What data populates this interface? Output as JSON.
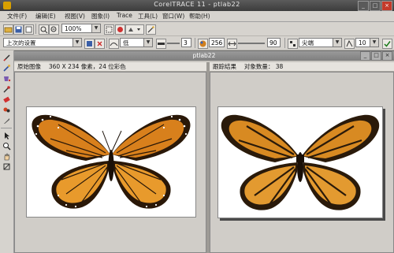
{
  "app": {
    "title": "CorelTRACE 11 - ptlab22"
  },
  "window_buttons": {
    "minimize": "_",
    "maximize": "□",
    "close": "×"
  },
  "menu": [
    "文件(F)",
    "编辑(E)",
    "视图(V)",
    "图象(I)",
    "Trace",
    "工具(L)",
    "窗口(W)",
    "帮助(H)"
  ],
  "toolbar1": {
    "zoom_value": "100%"
  },
  "toolbar2": {
    "preset": "上次的设置",
    "smoothness": "低",
    "width_value": "3",
    "colors_value": "256",
    "noise_value": "90",
    "node_type": "尖端",
    "node_value": "10"
  },
  "document": {
    "title": "ptlab22"
  },
  "left_pane": {
    "header": "原始图像　 360 X 234 像素，24 位彩色"
  },
  "right_pane": {
    "header": "跟踪结果　 对象数量： 38"
  },
  "icons": [
    "pencil-icon",
    "brush-icon",
    "fill-icon",
    "eyedropper-icon",
    "eraser-icon",
    "arrow-icon",
    "zoom-icon",
    "hand-icon",
    "pan-icon"
  ]
}
